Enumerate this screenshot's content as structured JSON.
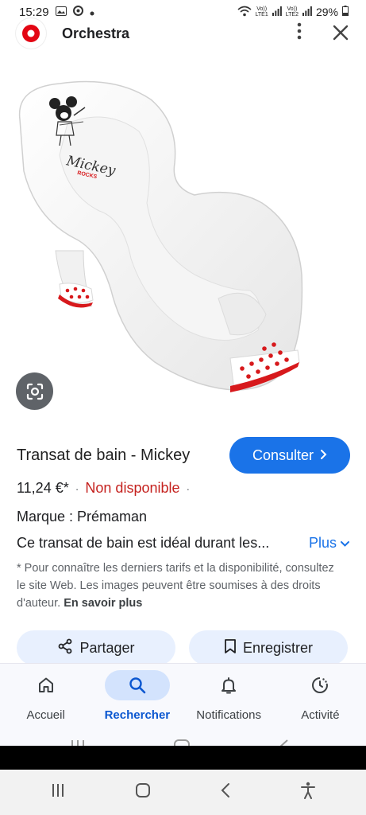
{
  "status_bar": {
    "time": "15:29",
    "lte1_top": "Vo))",
    "lte1_bottom": "LTE1",
    "lte2_top": "Vo))",
    "lte2_bottom": "LTE2",
    "battery": "29%"
  },
  "app_bar": {
    "title": "Orchestra"
  },
  "product": {
    "title": "Transat de bain - Mickey",
    "consult_label": "Consulter",
    "price": "11,24 €*",
    "separator": "·",
    "availability": "Non disponible",
    "brand": "Marque : Prémaman",
    "description": "Ce transat de bain est idéal durant les...",
    "more_label": "Plus",
    "disclaimer": "* Pour connaître les derniers tarifs et la disponibilité, consultez le site Web. Les images peuvent être soumises à des droits d'auteur.",
    "learn_more_label": "En savoir plus",
    "image_brand": "Mickey",
    "image_brand_sub": "ROCKS"
  },
  "actions": {
    "share_label": "Partager",
    "save_label": "Enregistrer"
  },
  "bottom_nav": {
    "items": [
      {
        "label": "Accueil",
        "icon": "home-icon"
      },
      {
        "label": "Rechercher",
        "icon": "search-icon"
      },
      {
        "label": "Notifications",
        "icon": "bell-icon"
      },
      {
        "label": "Activité",
        "icon": "activity-icon"
      }
    ],
    "active_index": 1
  },
  "colors": {
    "accent": "#1a73e8",
    "unavailable": "#c5221f",
    "active_nav_bg": "#d3e3fd",
    "logo_red": "#e30613"
  }
}
